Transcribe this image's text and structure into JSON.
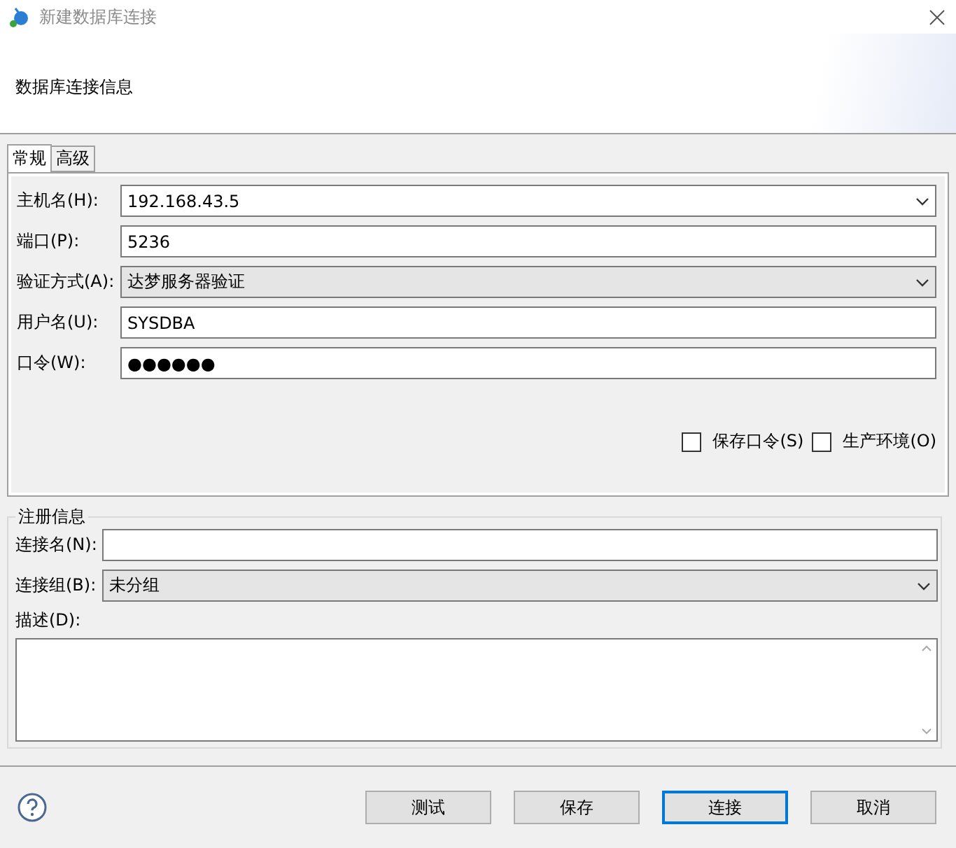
{
  "window": {
    "title": "新建数据库连接"
  },
  "header": {
    "title": "数据库连接信息"
  },
  "tabs": [
    {
      "label": "常规",
      "selected": true
    },
    {
      "label": "高级",
      "selected": false
    }
  ],
  "general": {
    "fields": [
      {
        "label": "主机名(H):",
        "kind": "combo",
        "value": "192.168.43.5"
      },
      {
        "label": "端口(P):",
        "kind": "text",
        "value": "5236"
      },
      {
        "label": "验证方式(A):",
        "kind": "select",
        "value": "达梦服务器验证"
      },
      {
        "label": "用户名(U):",
        "kind": "text",
        "value": "SYSDBA"
      },
      {
        "label": "口令(W):",
        "kind": "password",
        "value": "●●●●●●"
      }
    ],
    "checkboxes": [
      {
        "label": "保存口令(S)",
        "checked": false
      },
      {
        "label": "生产环境(O)",
        "checked": false
      }
    ]
  },
  "registration": {
    "title": "注册信息",
    "fields": [
      {
        "label": "连接名(N):",
        "kind": "text"
      },
      {
        "label": "连接组(B):",
        "kind": "select",
        "value": "未分组"
      },
      {
        "label": "描述(D):",
        "kind": "textarea"
      }
    ]
  },
  "buttons": [
    {
      "label": "测试",
      "default": false
    },
    {
      "label": "保存",
      "default": false
    },
    {
      "label": "连接",
      "default": true
    },
    {
      "label": "取消",
      "default": false
    }
  ]
}
